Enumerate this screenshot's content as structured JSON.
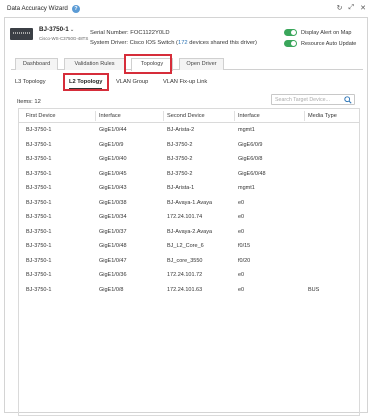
{
  "window": {
    "title": "Data Accuracy Wizard",
    "help_icon": "help-icon",
    "controls": [
      "refresh-icon",
      "expand-icon",
      "close-icon"
    ]
  },
  "device": {
    "name": "BJ-3750-1",
    "model": "Cisco-WS-C3750G-48TS",
    "serial_label": "Serial Number:",
    "serial_value": "FOC1122Y0LD",
    "driver_label": "System Driver:",
    "driver_name": "Cisco IOS Switch",
    "driver_paren_open": "(",
    "driver_count": "172",
    "driver_suffix": " devices shared this driver)"
  },
  "toggles": [
    {
      "label": "Display Alert on Map",
      "on": true
    },
    {
      "label": "Resource Auto Update",
      "on": true
    }
  ],
  "tabs": [
    {
      "label": "Dashboard",
      "active": false
    },
    {
      "label": "Validation Rules",
      "active": false
    },
    {
      "label": "Topology",
      "active": true
    },
    {
      "label": "Open Driver",
      "active": false
    }
  ],
  "subtabs": [
    {
      "label": "L3 Topology",
      "active": false
    },
    {
      "label": "L2 Topology",
      "active": true
    },
    {
      "label": "VLAN Group",
      "active": false
    },
    {
      "label": "VLAN Fix-up Link",
      "active": false
    }
  ],
  "items_count": "Items: 12",
  "search": {
    "placeholder": "Search Target Device..."
  },
  "highlight_color": "#d62d3a",
  "table": {
    "columns": [
      "First Device",
      "Interface",
      "Second Device",
      "Interface",
      "Media Type"
    ],
    "rows": [
      [
        "BJ-3750-1",
        "GigE1/0/44",
        "BJ-Arista-2",
        "mgmt1",
        ""
      ],
      [
        "BJ-3750-1",
        "GigE1/0/9",
        "BJ-3750-2",
        "GigE6/0/9",
        ""
      ],
      [
        "BJ-3750-1",
        "GigE1/0/40",
        "BJ-3750-2",
        "GigE6/0/8",
        ""
      ],
      [
        "BJ-3750-1",
        "GigE1/0/45",
        "BJ-3750-2",
        "GigE6/0/48",
        ""
      ],
      [
        "BJ-3750-1",
        "GigE1/0/43",
        "BJ-Arista-1",
        "mgmt1",
        ""
      ],
      [
        "BJ-3750-1",
        "GigE1/0/38",
        "BJ-Avaya-1.Avaya",
        "e0",
        ""
      ],
      [
        "BJ-3750-1",
        "GigE1/0/34",
        "172.24.101.74",
        "e0",
        ""
      ],
      [
        "BJ-3750-1",
        "GigE1/0/37",
        "BJ-Avaya-2.Avaya",
        "e0",
        ""
      ],
      [
        "BJ-3750-1",
        "GigE1/0/48",
        "BJ_L2_Core_6",
        "f0/15",
        ""
      ],
      [
        "BJ-3750-1",
        "GigE1/0/47",
        "BJ_core_3550",
        "f0/20",
        ""
      ],
      [
        "BJ-3750-1",
        "GigE1/0/36",
        "172.24.101.72",
        "e0",
        ""
      ],
      [
        "BJ-3750-1",
        "GigE1/0/8",
        "172.24.101.63",
        "e0",
        "BUS"
      ]
    ]
  }
}
